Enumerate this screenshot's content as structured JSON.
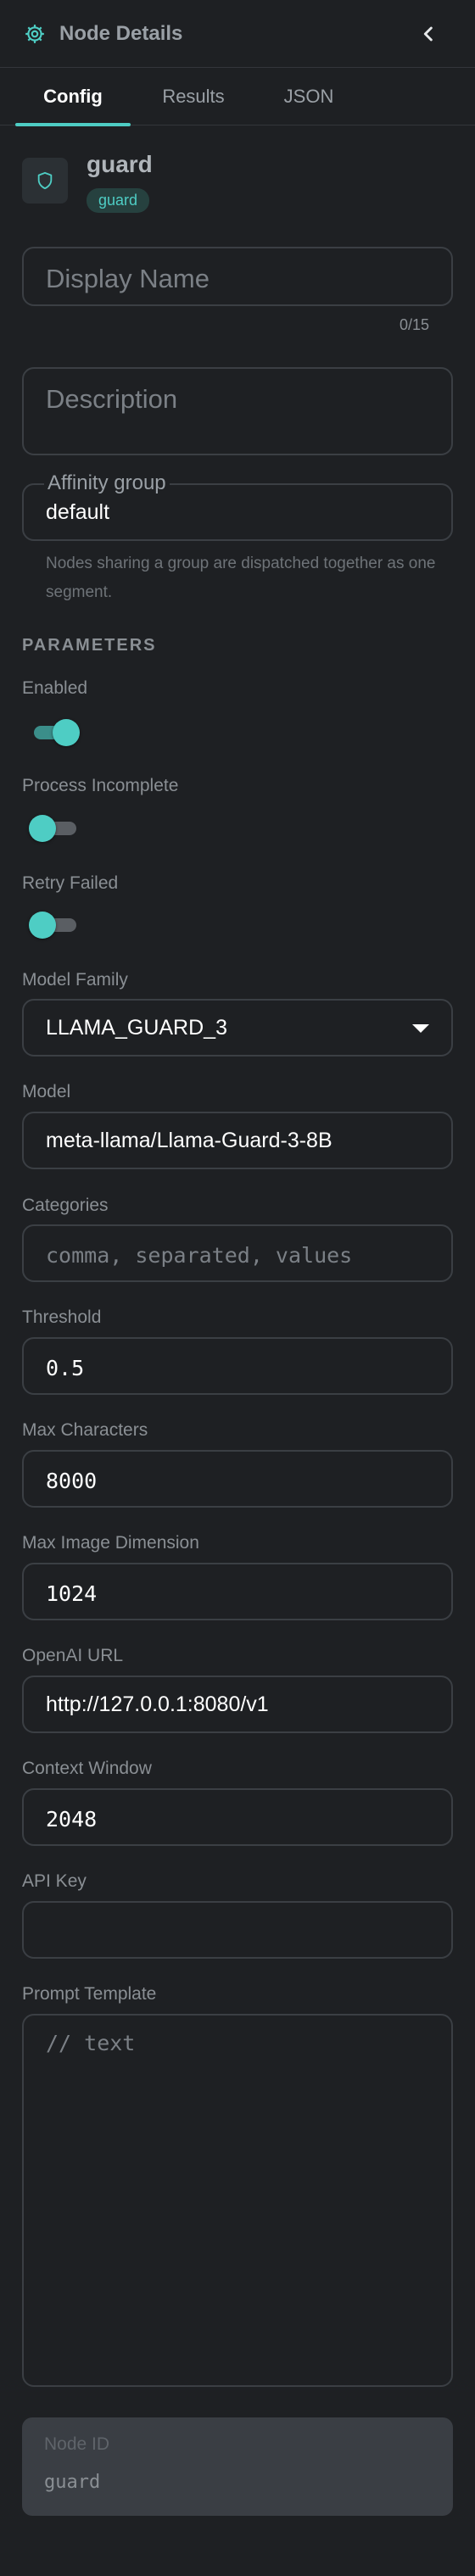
{
  "header": {
    "title": "Node Details"
  },
  "tabs": [
    {
      "label": "Config",
      "active": true
    },
    {
      "label": "Results",
      "active": false
    },
    {
      "label": "JSON",
      "active": false
    }
  ],
  "node": {
    "name": "guard",
    "badge": "guard",
    "icon": "shield-icon"
  },
  "display_name": {
    "placeholder": "Display Name",
    "value": "",
    "counter": "0/15"
  },
  "description": {
    "placeholder": "Description",
    "value": ""
  },
  "affinity_group": {
    "label": "Affinity group",
    "value": "default",
    "helper": "Nodes sharing a group are dispatched together as one segment."
  },
  "parameters": {
    "section_label": "PARAMETERS",
    "enabled": {
      "label": "Enabled",
      "checked": true
    },
    "process_incomplete": {
      "label": "Process Incomplete",
      "checked": false
    },
    "retry_failed": {
      "label": "Retry Failed",
      "checked": false
    },
    "model_family": {
      "label": "Model Family",
      "value": "LLAMA_GUARD_3"
    },
    "model": {
      "label": "Model",
      "value": "meta-llama/Llama-Guard-3-8B"
    },
    "categories": {
      "label": "Categories",
      "placeholder": "comma, separated, values",
      "value": ""
    },
    "threshold": {
      "label": "Threshold",
      "value": "0.5"
    },
    "max_characters": {
      "label": "Max Characters",
      "value": "8000"
    },
    "max_image_dimension": {
      "label": "Max Image Dimension",
      "value": "1024"
    },
    "openai_url": {
      "label": "OpenAI URL",
      "value": "http://127.0.0.1:8080/v1"
    },
    "context_window": {
      "label": "Context Window",
      "value": "2048"
    },
    "api_key": {
      "label": "API Key",
      "value": ""
    },
    "prompt_template": {
      "label": "Prompt Template",
      "placeholder": "// text"
    }
  },
  "node_id": {
    "label": "Node ID",
    "value": "guard"
  },
  "colors": {
    "accent": "#4ecdc4",
    "background": "#1e2023",
    "border": "#3b3f44"
  }
}
